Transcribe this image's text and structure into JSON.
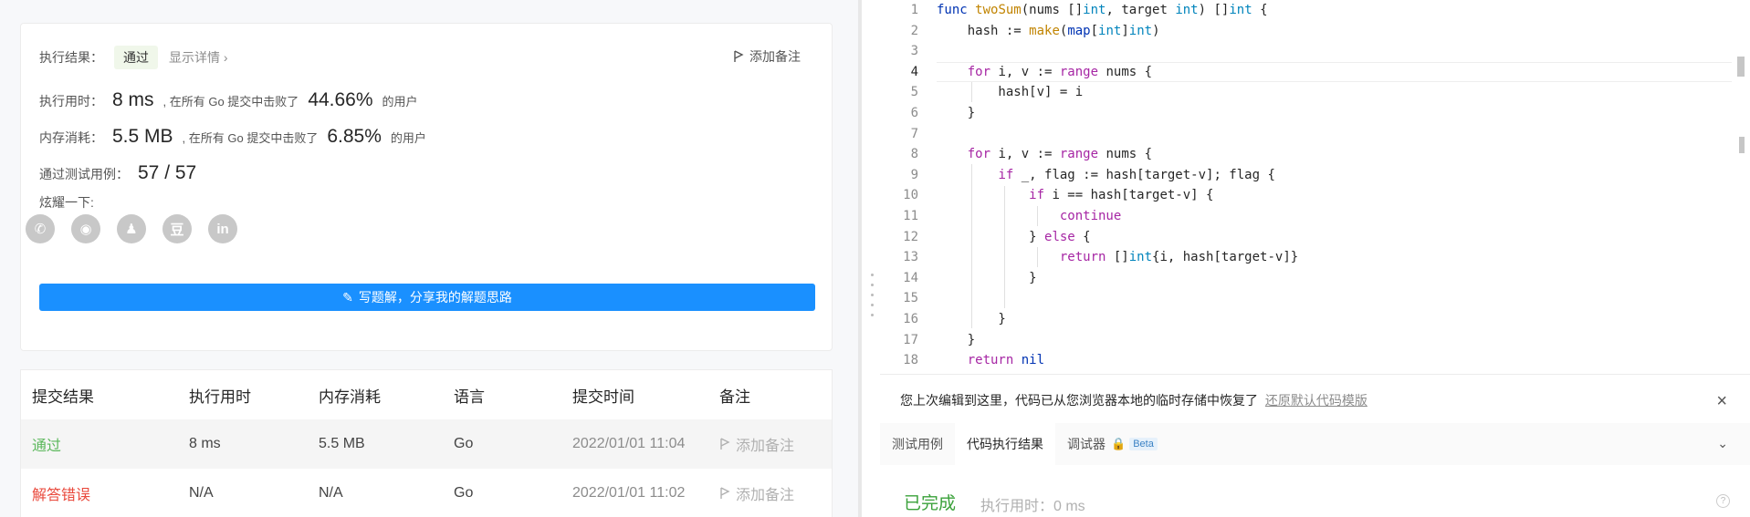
{
  "result": {
    "status_label": "执行结果：",
    "status_value": "通过",
    "details_link": "显示详情 ›",
    "add_note": "添加备注",
    "runtime_label": "执行用时：",
    "runtime_value": "8 ms",
    "runtime_text": ", 在所有 Go 提交中击败了",
    "runtime_pct": "44.66%",
    "runtime_suffix": "的用户",
    "memory_label": "内存消耗：",
    "memory_value": "5.5 MB",
    "memory_text": ", 在所有 Go 提交中击败了",
    "memory_pct": "6.85%",
    "memory_suffix": "的用户",
    "tests_label": "通过测试用例：",
    "tests_value": "57 / 57",
    "share_label": "炫耀一下:",
    "share_icons": [
      "wechat-icon",
      "weibo-icon",
      "qq-icon",
      "douban-icon",
      "linkedin-icon"
    ],
    "share_glyphs": [
      "✆",
      "◉",
      "♟",
      "豆",
      "in"
    ],
    "write_button": "写题解，分享我的解题思路"
  },
  "submissions": {
    "headers": [
      "提交结果",
      "执行用时",
      "内存消耗",
      "语言",
      "提交时间",
      "备注"
    ],
    "rows": [
      {
        "status": "通过",
        "time": "8 ms",
        "memory": "5.5 MB",
        "lang": "Go",
        "submitted": "2022/01/01 11:04",
        "note": "添加备注"
      },
      {
        "status": "解答错误",
        "time": "N/A",
        "memory": "N/A",
        "lang": "Go",
        "submitted": "2022/01/01 11:02",
        "note": "添加备注"
      }
    ]
  },
  "editor": {
    "line_numbers": [
      "1",
      "2",
      "3",
      "4",
      "5",
      "6",
      "7",
      "8",
      "9",
      "10",
      "11",
      "12",
      "13",
      "14",
      "15",
      "16",
      "17",
      "18"
    ]
  },
  "bottom_panel": {
    "notice": "您上次编辑到这里，代码已从您浏览器本地的临时存储中恢复了",
    "notice_link": "还原默认代码模版",
    "tabs": [
      "测试用例",
      "代码执行结果",
      "调试器"
    ],
    "beta": "Beta",
    "status": "已完成",
    "elapsed": "执行用时：0 ms"
  },
  "colors": {
    "accent": "#1a90ff",
    "pass": "#5cb85c",
    "fail": "#e9493c"
  }
}
